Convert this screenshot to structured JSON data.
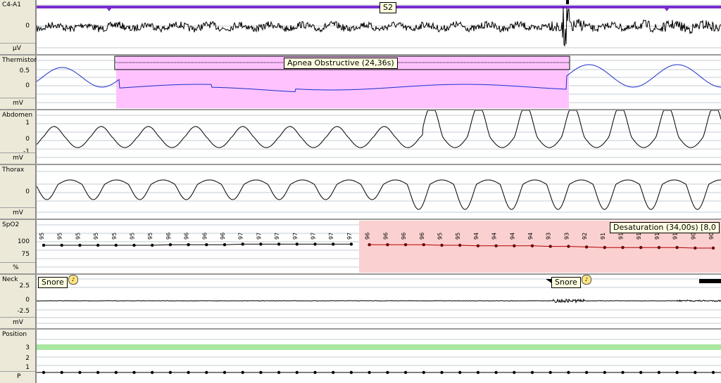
{
  "channels": [
    {
      "name": "C4-A1",
      "unit": "µV",
      "ticks": [
        "0"
      ]
    },
    {
      "name": "Thermistor",
      "unit": "mV",
      "ticks": [
        "0.5",
        "0"
      ]
    },
    {
      "name": "Abdomen",
      "unit": "mV",
      "ticks": [
        "1",
        "0",
        "-1"
      ]
    },
    {
      "name": "Thorax",
      "unit": "mV",
      "ticks": [
        "0"
      ]
    },
    {
      "name": "SpO2",
      "unit": "%",
      "ticks": [
        "100",
        "75"
      ]
    },
    {
      "name": "Neck",
      "unit": "mV",
      "ticks": [
        "2.5",
        "0",
        "-2.5"
      ]
    },
    {
      "name": "Position",
      "unit": "P",
      "ticks": [
        "3",
        "2",
        "1"
      ]
    }
  ],
  "events": {
    "stage": "S2",
    "apnea": "Apnea Obstructive (24,36s)",
    "desaturation": "Desaturation (34,00s) [8,0",
    "snore1": "Snore",
    "snore2": "Snore"
  },
  "spo2_values": [
    95,
    95,
    95,
    95,
    95,
    95,
    95,
    96,
    96,
    96,
    96,
    97,
    97,
    97,
    97,
    97,
    97,
    97,
    96,
    96,
    96,
    96,
    95,
    95,
    94,
    94,
    94,
    94,
    93,
    93,
    92,
    91,
    91,
    91,
    91,
    91,
    90,
    90
  ],
  "colors": {
    "eeg": "#000000",
    "thermistor": "#1a2ec8",
    "hypnogram": "#7a2bd0",
    "apnea_fill": "#ffc2ff",
    "desat_fill": "#fbd0d0",
    "spo2_line_normal": "#000000",
    "spo2_line_desat": "#b00000",
    "position": "#a8e8a0"
  }
}
